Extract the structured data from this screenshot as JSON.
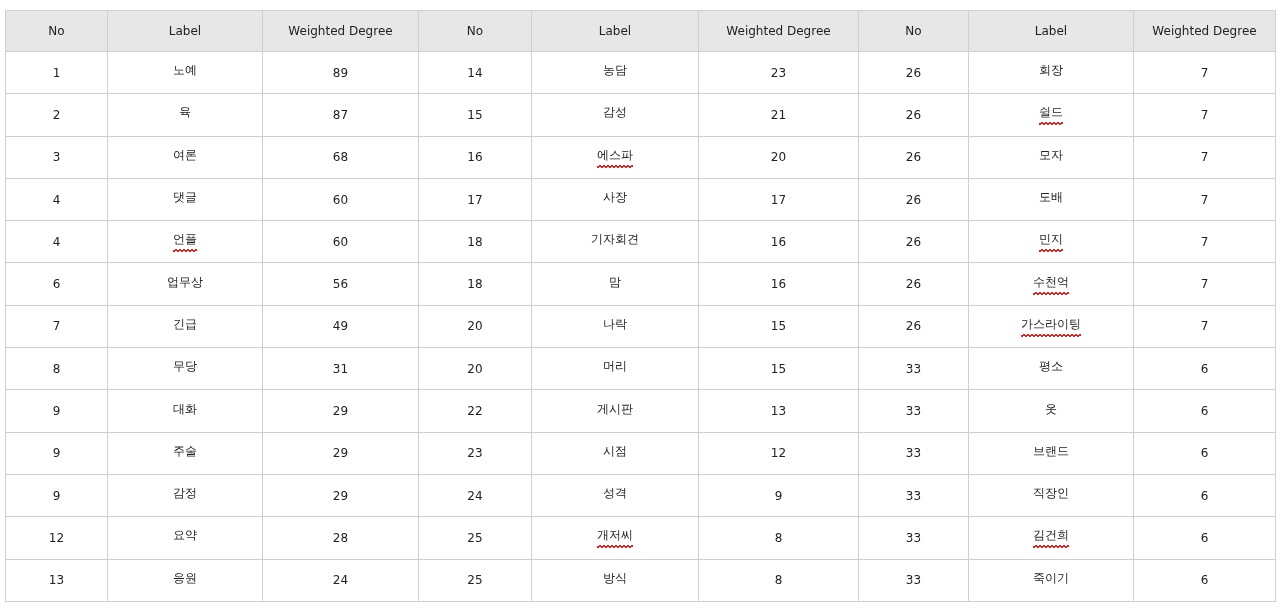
{
  "table": {
    "columns": [
      "No",
      "Label",
      "Weighted Degree",
      "No",
      "Label",
      "Weighted Degree",
      "No",
      "Label",
      "Weighted Degree"
    ],
    "rows": [
      [
        {
          "no": "1",
          "label": "노예",
          "misspelled": false,
          "degree": "89"
        },
        {
          "no": "14",
          "label": "농담",
          "misspelled": false,
          "degree": "23"
        },
        {
          "no": "26",
          "label": "회장",
          "misspelled": false,
          "degree": "7"
        }
      ],
      [
        {
          "no": "2",
          "label": "육",
          "misspelled": false,
          "degree": "87"
        },
        {
          "no": "15",
          "label": "감성",
          "misspelled": false,
          "degree": "21"
        },
        {
          "no": "26",
          "label": "쉴드",
          "misspelled": true,
          "degree": "7"
        }
      ],
      [
        {
          "no": "3",
          "label": "여론",
          "misspelled": false,
          "degree": "68"
        },
        {
          "no": "16",
          "label": "에스파",
          "misspelled": true,
          "degree": "20"
        },
        {
          "no": "26",
          "label": "모자",
          "misspelled": false,
          "degree": "7"
        }
      ],
      [
        {
          "no": "4",
          "label": "댓글",
          "misspelled": false,
          "degree": "60"
        },
        {
          "no": "17",
          "label": "사장",
          "misspelled": false,
          "degree": "17"
        },
        {
          "no": "26",
          "label": "도배",
          "misspelled": false,
          "degree": "7"
        }
      ],
      [
        {
          "no": "4",
          "label": "언플",
          "misspelled": true,
          "degree": "60"
        },
        {
          "no": "18",
          "label": "기자회견",
          "misspelled": false,
          "degree": "16"
        },
        {
          "no": "26",
          "label": "민지",
          "misspelled": true,
          "degree": "7"
        }
      ],
      [
        {
          "no": "6",
          "label": "업무상",
          "misspelled": false,
          "degree": "56"
        },
        {
          "no": "18",
          "label": "맘",
          "misspelled": false,
          "degree": "16"
        },
        {
          "no": "26",
          "label": "수천억",
          "misspelled": true,
          "degree": "7"
        }
      ],
      [
        {
          "no": "7",
          "label": "긴급",
          "misspelled": false,
          "degree": "49"
        },
        {
          "no": "20",
          "label": "나락",
          "misspelled": false,
          "degree": "15"
        },
        {
          "no": "26",
          "label": "가스라이팅",
          "misspelled": true,
          "degree": "7"
        }
      ],
      [
        {
          "no": "8",
          "label": "무당",
          "misspelled": false,
          "degree": "31"
        },
        {
          "no": "20",
          "label": "머리",
          "misspelled": false,
          "degree": "15"
        },
        {
          "no": "33",
          "label": "평소",
          "misspelled": false,
          "degree": "6"
        }
      ],
      [
        {
          "no": "9",
          "label": "대화",
          "misspelled": false,
          "degree": "29"
        },
        {
          "no": "22",
          "label": "게시판",
          "misspelled": false,
          "degree": "13"
        },
        {
          "no": "33",
          "label": "옷",
          "misspelled": false,
          "degree": "6"
        }
      ],
      [
        {
          "no": "9",
          "label": "주술",
          "misspelled": false,
          "degree": "29"
        },
        {
          "no": "23",
          "label": "시점",
          "misspelled": false,
          "degree": "12"
        },
        {
          "no": "33",
          "label": "브랜드",
          "misspelled": false,
          "degree": "6"
        }
      ],
      [
        {
          "no": "9",
          "label": "감정",
          "misspelled": false,
          "degree": "29"
        },
        {
          "no": "24",
          "label": "성격",
          "misspelled": false,
          "degree": "9"
        },
        {
          "no": "33",
          "label": "직장인",
          "misspelled": false,
          "degree": "6"
        }
      ],
      [
        {
          "no": "12",
          "label": "요약",
          "misspelled": false,
          "degree": "28"
        },
        {
          "no": "25",
          "label": "개저씨",
          "misspelled": true,
          "degree": "8"
        },
        {
          "no": "33",
          "label": "김건희",
          "misspelled": true,
          "degree": "6"
        }
      ],
      [
        {
          "no": "13",
          "label": "응원",
          "misspelled": false,
          "degree": "24"
        },
        {
          "no": "25",
          "label": "방식",
          "misspelled": false,
          "degree": "8"
        },
        {
          "no": "33",
          "label": "죽이기",
          "misspelled": false,
          "degree": "6"
        }
      ]
    ]
  }
}
